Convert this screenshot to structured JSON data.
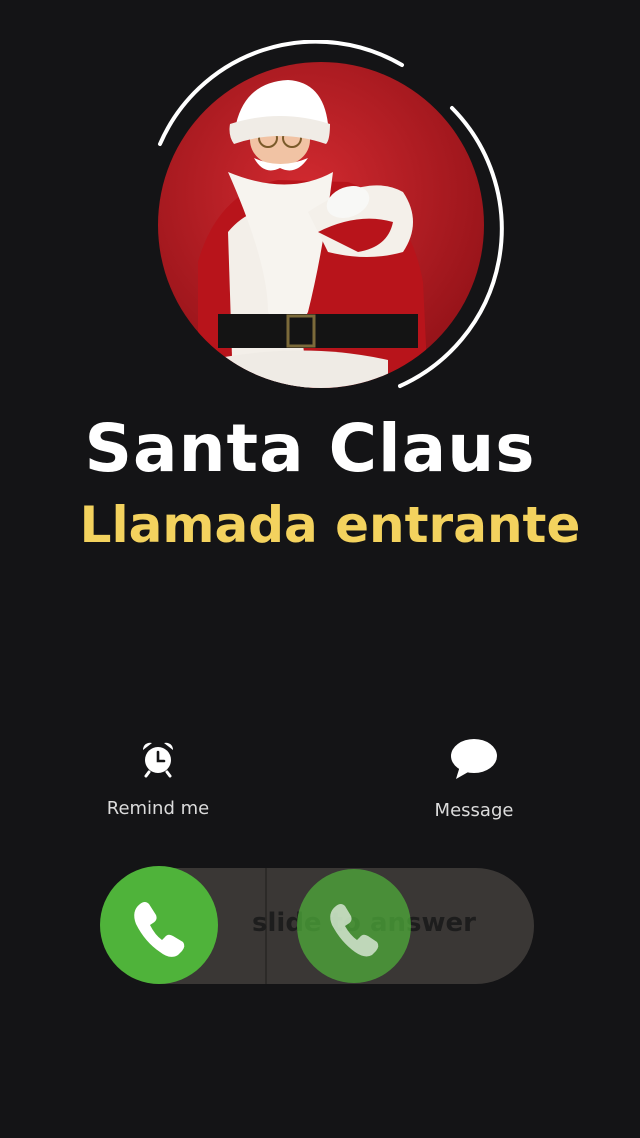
{
  "caller": {
    "name": "Santa Claus",
    "status": "Llamada entrante"
  },
  "actions": {
    "remind_label": "Remind me",
    "message_label": "Message"
  },
  "slider": {
    "hint": "slide to answer"
  },
  "colors": {
    "background": "#141416",
    "status_text": "#f3d25e",
    "answer_green": "#4fb33a",
    "track": "#3a3735"
  },
  "icons": {
    "remind": "alarm-clock-icon",
    "message": "speech-bubble-icon",
    "answer": "phone-handset-icon"
  }
}
